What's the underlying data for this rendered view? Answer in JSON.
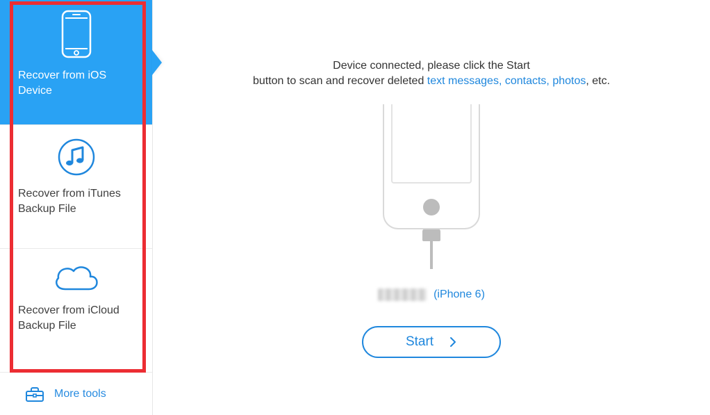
{
  "sidebar": {
    "items": [
      {
        "label": "Recover from iOS Device",
        "active": true
      },
      {
        "label": "Recover from iTunes Backup File",
        "active": false
      },
      {
        "label": "Recover from iCloud Backup File",
        "active": false
      }
    ],
    "more_tools_label": "More tools"
  },
  "main": {
    "instruction_line1": "Device connected, please click the Start",
    "instruction_line2_prefix": "button to scan and recover deleted ",
    "instruction_links": "text messages, contacts, photos",
    "instruction_line2_suffix": ", etc.",
    "device_model": "(iPhone 6)",
    "start_label": "Start"
  },
  "colors": {
    "accent": "#29a2f4",
    "link": "#1f87dd",
    "highlight_frame": "#ec2d33"
  }
}
